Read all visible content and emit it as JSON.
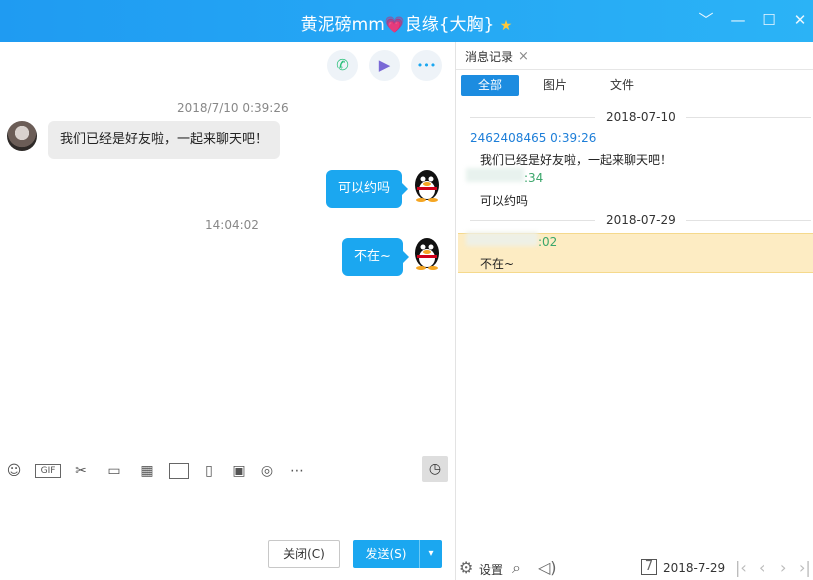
{
  "title": {
    "name": "黄泥磅mm",
    "heart": "💗",
    "remark": "良缘{大胸}",
    "star": "★"
  },
  "window_controls": {
    "dropdown": "﹀",
    "minimize": "—",
    "maximize": "☐",
    "close": "✕"
  },
  "top_actions": {
    "phone": "✆",
    "video": "▶",
    "more": "•••"
  },
  "chat": {
    "time1": "2018/7/10 0:39:26",
    "msg_in": "我们已经是好友啦，一起来聊天吧！",
    "msg_out1": "可以约吗",
    "time2": "14:04:02",
    "msg_out2": "不在~"
  },
  "toolbar": {
    "emoji": "☺",
    "gif": "GIF",
    "screenshot": "✂",
    "folder": "▭",
    "image": "▦",
    "shake": "▯",
    "redpacket": "▣",
    "voice": "◎",
    "more": "⋯",
    "history": "◷"
  },
  "buttons": {
    "close": "关闭(C)",
    "send": "发送(S)",
    "send_arrow": "▾"
  },
  "history": {
    "tab_label": "消息记录",
    "tab_close": "×",
    "filters": [
      "全部",
      "图片",
      "文件"
    ],
    "date1": "2018-07-10",
    "sender1": "2462408465 0:39:26",
    "msg1": "我们已经是好友啦，一起来聊天吧！",
    "time2_partial": ":34",
    "msg2": "可以约吗",
    "date2": "2018-07-29",
    "time3_partial": ":02",
    "msg3": "不在~"
  },
  "footer": {
    "settings_label": "设置",
    "date": "2018-7-29",
    "nav": [
      "|‹",
      "‹",
      "›",
      "›|"
    ]
  }
}
